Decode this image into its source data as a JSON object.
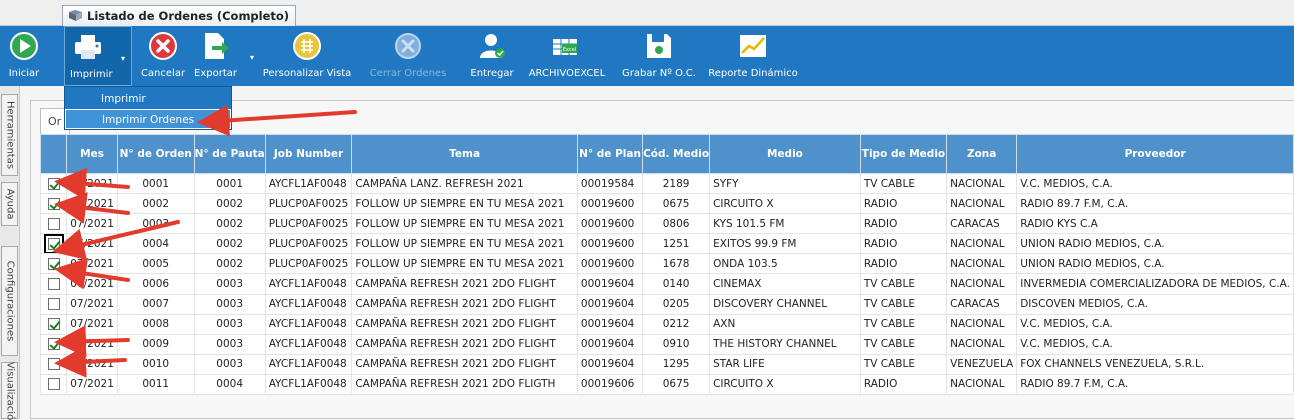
{
  "window": {
    "title": "Listado de Ordenes (Completo)"
  },
  "toolbar": {
    "iniciar": "Iniciar",
    "imprimir": "Imprimir",
    "cancelar": "Cancelar",
    "exportar": "Exportar",
    "personalizar": "Personalizar Vista",
    "cerrar": "Cerrar Ordenes",
    "entregar": "Entregar",
    "archivo": "ARCHIVOEXCEL",
    "excel_badge": "Excel",
    "grabar": "Grabar Nº O.C.",
    "reporte": "Reporte Dinámico"
  },
  "print_menu": {
    "item1": "Imprimir",
    "item2": "Imprimir Ordenes"
  },
  "side_tabs": {
    "herramientas": "Herramientas",
    "ayuda": "Ayuda",
    "configuraciones": "Configuraciones",
    "visualizacion": "Visualizació"
  },
  "subtab": {
    "label": "Or"
  },
  "columns": [
    "Mes",
    "N° de Orden",
    "N° de Pauta",
    "Job Number",
    "Tema",
    "N° de Plan",
    "Cód. Medio",
    "Medio",
    "Tipo de Medio",
    "Zona",
    "Proveedor"
  ],
  "rows": [
    {
      "checked": true,
      "mes": "07/2021",
      "orden": "0001",
      "pauta": "0001",
      "job": "AYCFL1AF0048",
      "tema": "CAMPAÑA LANZ. REFRESH 2021",
      "plan": "00019584",
      "cod": "2189",
      "medio": "SYFY",
      "tipo": "TV CABLE",
      "zona": "NACIONAL",
      "proveedor": "V.C. MEDIOS, C.A."
    },
    {
      "checked": true,
      "mes": "07/2021",
      "orden": "0002",
      "pauta": "0002",
      "job": "PLUCP0AF0025",
      "tema": "FOLLOW UP SIEMPRE EN TU MESA 2021",
      "plan": "00019600",
      "cod": "0675",
      "medio": "CIRCUITO X",
      "tipo": "RADIO",
      "zona": "NACIONAL",
      "proveedor": "RADIO 89.7 F.M, C.A."
    },
    {
      "checked": false,
      "mes": "07/2021",
      "orden": "0003",
      "pauta": "0002",
      "job": "PLUCP0AF0025",
      "tema": "FOLLOW UP SIEMPRE EN TU MESA 2021",
      "plan": "00019600",
      "cod": "0806",
      "medio": "KYS 101.5 FM",
      "tipo": "RADIO",
      "zona": "CARACAS",
      "proveedor": "RADIO KYS C.A"
    },
    {
      "checked": true,
      "mes": "07/2021",
      "orden": "0004",
      "pauta": "0002",
      "job": "PLUCP0AF0025",
      "tema": "FOLLOW UP SIEMPRE EN TU MESA 2021",
      "plan": "00019600",
      "cod": "1251",
      "medio": "EXITOS 99.9 FM",
      "tipo": "RADIO",
      "zona": "NACIONAL",
      "proveedor": "UNION RADIO MEDIOS, C.A."
    },
    {
      "checked": true,
      "mes": "07/2021",
      "orden": "0005",
      "pauta": "0002",
      "job": "PLUCP0AF0025",
      "tema": "FOLLOW UP SIEMPRE EN TU MESA 2021",
      "plan": "00019600",
      "cod": "1678",
      "medio": "ONDA 103.5",
      "tipo": "RADIO",
      "zona": "NACIONAL",
      "proveedor": "UNION RADIO MEDIOS, C.A."
    },
    {
      "checked": false,
      "mes": "07/2021",
      "orden": "0006",
      "pauta": "0003",
      "job": "AYCFL1AF0048",
      "tema": "CAMPAÑA REFRESH 2021 2DO FLIGHT",
      "plan": "00019604",
      "cod": "0140",
      "medio": "CINEMAX",
      "tipo": "TV CABLE",
      "zona": "NACIONAL",
      "proveedor": "INVERMEDIA COMERCIALIZADORA DE MEDIOS, C.A."
    },
    {
      "checked": false,
      "mes": "07/2021",
      "orden": "0007",
      "pauta": "0003",
      "job": "AYCFL1AF0048",
      "tema": "CAMPAÑA REFRESH 2021 2DO FLIGHT",
      "plan": "00019604",
      "cod": "0205",
      "medio": "DISCOVERY CHANNEL",
      "tipo": "TV CABLE",
      "zona": "CARACAS",
      "proveedor": "DISCOVEN MEDIOS, C.A."
    },
    {
      "checked": true,
      "mes": "07/2021",
      "orden": "0008",
      "pauta": "0003",
      "job": "AYCFL1AF0048",
      "tema": "CAMPAÑA REFRESH 2021 2DO FLIGHT",
      "plan": "00019604",
      "cod": "0212",
      "medio": "AXN",
      "tipo": "TV CABLE",
      "zona": "NACIONAL",
      "proveedor": "V.C. MEDIOS, C.A."
    },
    {
      "checked": true,
      "mes": "07/2021",
      "orden": "0009",
      "pauta": "0003",
      "job": "AYCFL1AF0048",
      "tema": "CAMPAÑA REFRESH 2021 2DO FLIGHT",
      "plan": "00019604",
      "cod": "0910",
      "medio": "THE HISTORY CHANNEL",
      "tipo": "TV CABLE",
      "zona": "NACIONAL",
      "proveedor": "V.C. MEDIOS, C.A."
    },
    {
      "checked": false,
      "mes": "07/2021",
      "orden": "0010",
      "pauta": "0003",
      "job": "AYCFL1AF0048",
      "tema": "CAMPAÑA REFRESH 2021 2DO FLIGHT",
      "plan": "00019604",
      "cod": "1295",
      "medio": "STAR LIFE",
      "tipo": "TV CABLE",
      "zona": "VENEZUELA",
      "proveedor": "FOX CHANNELS VENEZUELA, S.R.L."
    },
    {
      "checked": false,
      "mes": "07/2021",
      "orden": "0011",
      "pauta": "0004",
      "job": "AYCFL1AF0048",
      "tema": "CAMPAÑA REFRESH 2021 2DO FLIGTH",
      "plan": "00019606",
      "cod": "0675",
      "medio": "CIRCUITO X",
      "tipo": "RADIO",
      "zona": "NACIONAL",
      "proveedor": "RADIO 89.7 F.M, C.A."
    }
  ],
  "colors": {
    "ribbon": "#1f78c1",
    "header": "#4f91ca",
    "annotation": "#e23b2e"
  }
}
